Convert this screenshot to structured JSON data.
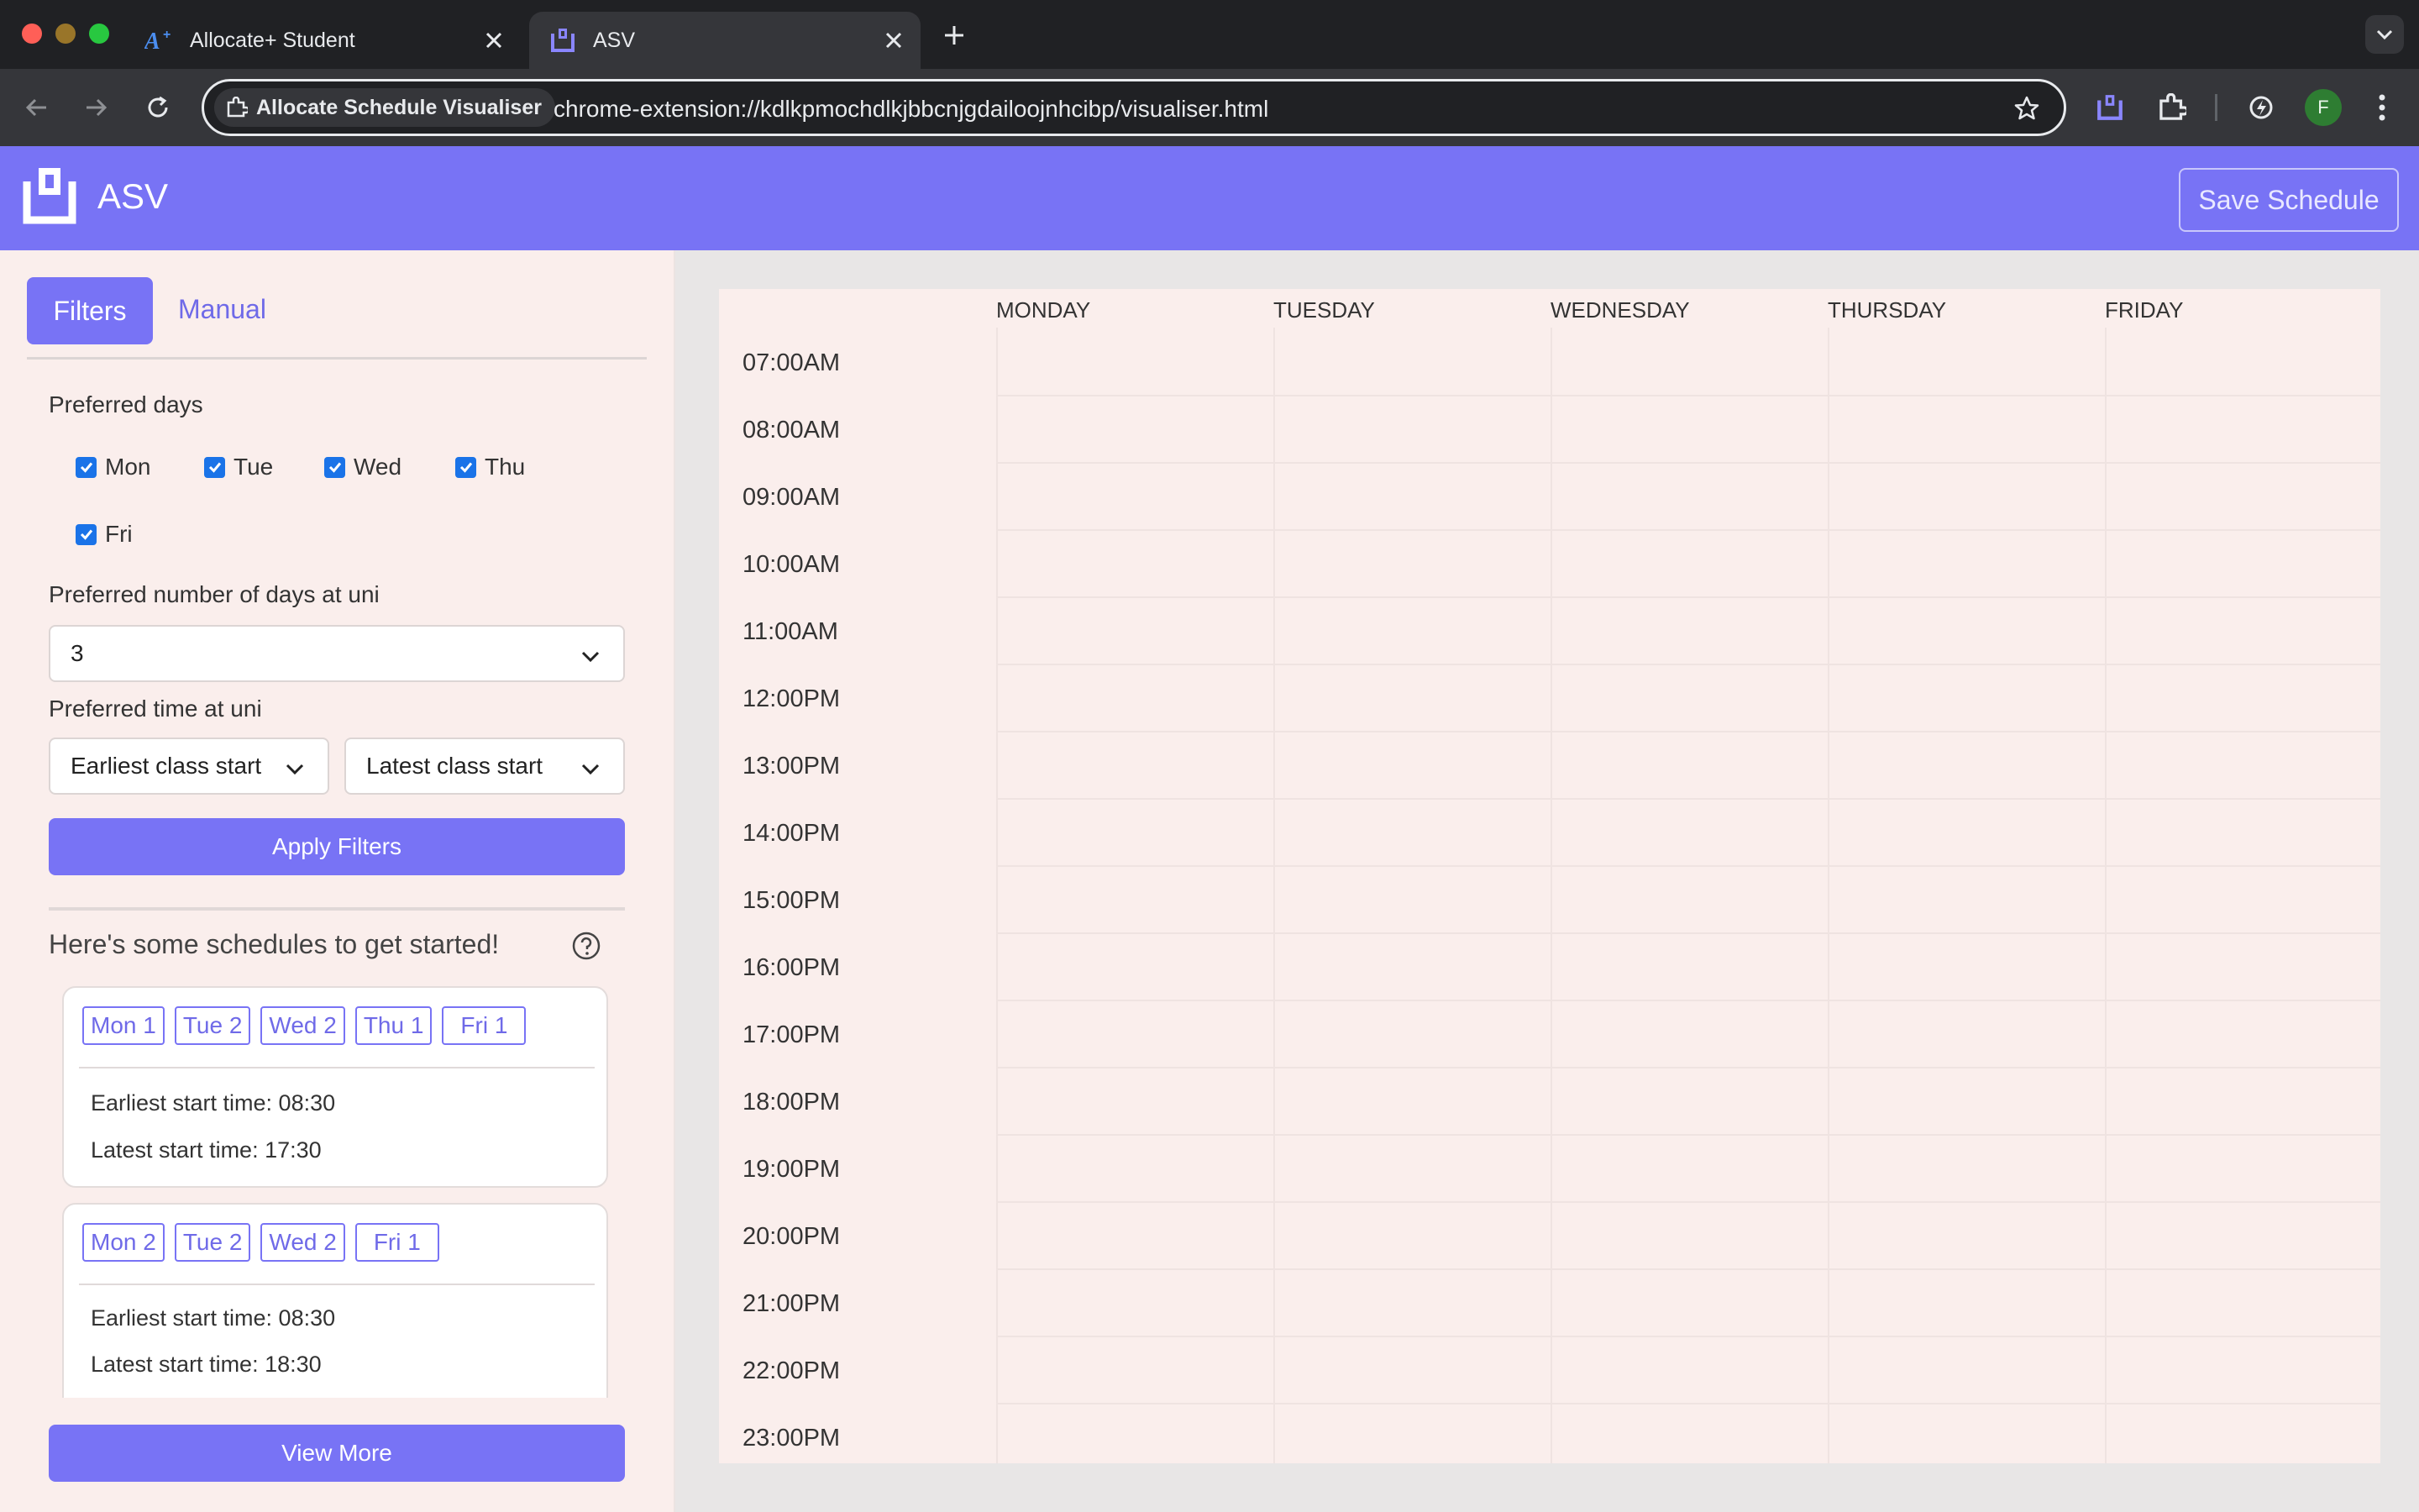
{
  "browser": {
    "tabs": [
      {
        "title": "Allocate+ Student",
        "active": false
      },
      {
        "title": "ASV",
        "active": true
      }
    ],
    "site_chip": "Allocate Schedule Visualiser",
    "url": "chrome-extension://kdlkpmochdlkjbbcnjgdailoojnhcibp/visualiser.html",
    "profile_initial": "F"
  },
  "app": {
    "name": "ASV",
    "save_label": "Save Schedule",
    "accent": "#7873f5"
  },
  "sidebar": {
    "tabs": {
      "filters": "Filters",
      "manual": "Manual"
    },
    "preferred_days_label": "Preferred days",
    "days": [
      {
        "label": "Mon",
        "checked": true
      },
      {
        "label": "Tue",
        "checked": true
      },
      {
        "label": "Wed",
        "checked": true
      },
      {
        "label": "Thu",
        "checked": true
      },
      {
        "label": "Fri",
        "checked": true
      }
    ],
    "num_days_label": "Preferred number of days at uni",
    "num_days_value": "3",
    "time_label": "Preferred time at uni",
    "earliest_label": "Earliest class start",
    "latest_label": "Latest class start",
    "apply_label": "Apply Filters",
    "suggest_title": "Here's some schedules to get started!",
    "schedules": [
      {
        "chips": [
          "Mon 1",
          "Tue 2",
          "Wed 2",
          "Thu 1",
          "Fri 1"
        ],
        "earliest": "Earliest start time: 08:30",
        "latest": "Latest start time: 17:30"
      },
      {
        "chips": [
          "Mon 2",
          "Tue 2",
          "Wed 2",
          "Fri 1"
        ],
        "earliest": "Earliest start time: 08:30",
        "latest": "Latest start time: 18:30"
      }
    ],
    "view_more_label": "View More"
  },
  "calendar": {
    "days": [
      "MONDAY",
      "TUESDAY",
      "WEDNESDAY",
      "THURSDAY",
      "FRIDAY"
    ],
    "times": [
      "07:00AM",
      "08:00AM",
      "09:00AM",
      "10:00AM",
      "11:00AM",
      "12:00PM",
      "13:00PM",
      "14:00PM",
      "15:00PM",
      "16:00PM",
      "17:00PM",
      "18:00PM",
      "19:00PM",
      "20:00PM",
      "21:00PM",
      "22:00PM",
      "23:00PM"
    ]
  }
}
